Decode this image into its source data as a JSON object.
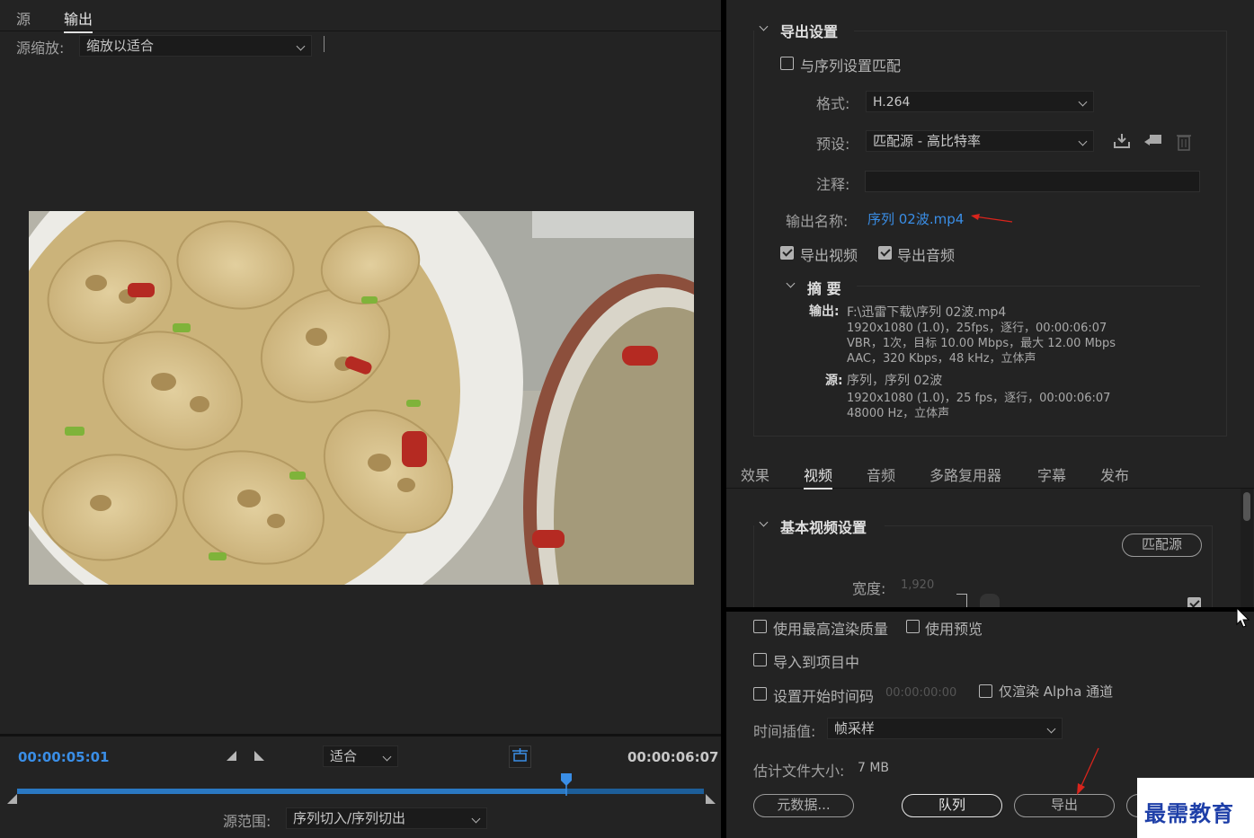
{
  "source_tabs": {
    "source": "源",
    "output": "输出"
  },
  "source_scale": {
    "label": "源缩放:",
    "value": "缩放以适合"
  },
  "timeline": {
    "current_time": "00:00:05:01",
    "fit_value": "适合",
    "end_time": "00:00:06:07",
    "playhead_fraction": 0.8,
    "range_label": "源范围:",
    "range_value": "序列切入/序列切出"
  },
  "export_settings": {
    "section_title": "导出设置",
    "match_sequence_label": "与序列设置匹配",
    "format_label": "格式:",
    "format_value": "H.264",
    "preset_label": "预设:",
    "preset_value": "匹配源 - 高比特率",
    "comment_label": "注释:",
    "comment_value": "",
    "output_name_label": "输出名称:",
    "output_name_value": "序列 02波.mp4",
    "export_video_label": "导出视频",
    "export_audio_label": "导出音频"
  },
  "summary": {
    "title": "摘 要",
    "output_label": "输出:",
    "output_lines": [
      "F:\\迅雷下载\\序列 02波.mp4",
      "1920x1080 (1.0)，25fps，逐行，00:00:06:07",
      "VBR，1次，目标 10.00 Mbps，最大 12.00 Mbps",
      "AAC，320 Kbps，48  kHz，立体声"
    ],
    "source_label": "源:",
    "source_lines": [
      "序列，序列 02波",
      "1920x1080 (1.0)，25 fps，逐行，00:00:06:07",
      "48000 Hz，立体声"
    ]
  },
  "settings_tabs": [
    "效果",
    "视频",
    "音频",
    "多路复用器",
    "字幕",
    "发布"
  ],
  "active_settings_tab": "视频",
  "video": {
    "section_title": "基本视频设置",
    "match_source_button": "匹配源",
    "width_label": "宽度:",
    "width_value": "1,920"
  },
  "bottom": {
    "max_render_quality": "使用最高渲染质量",
    "use_previews": "使用预览",
    "import_into_project": "导入到项目中",
    "set_start_timecode": "设置开始时间码",
    "start_timecode_value": "00:00:00:00",
    "render_alpha_only": "仅渲染 Alpha 通道",
    "time_interpolation_label": "时间插值:",
    "time_interpolation_value": "帧采样",
    "estimated_size_label": "估计文件大小:",
    "estimated_size_value": "7 MB",
    "metadata_button": "元数据...",
    "queue_button": "队列",
    "export_button": "导出"
  },
  "watermark": "最需教育",
  "colors": {
    "accent_blue": "#3a8ee6",
    "annotation_red": "#d9241c",
    "panel_bg": "#232323"
  }
}
